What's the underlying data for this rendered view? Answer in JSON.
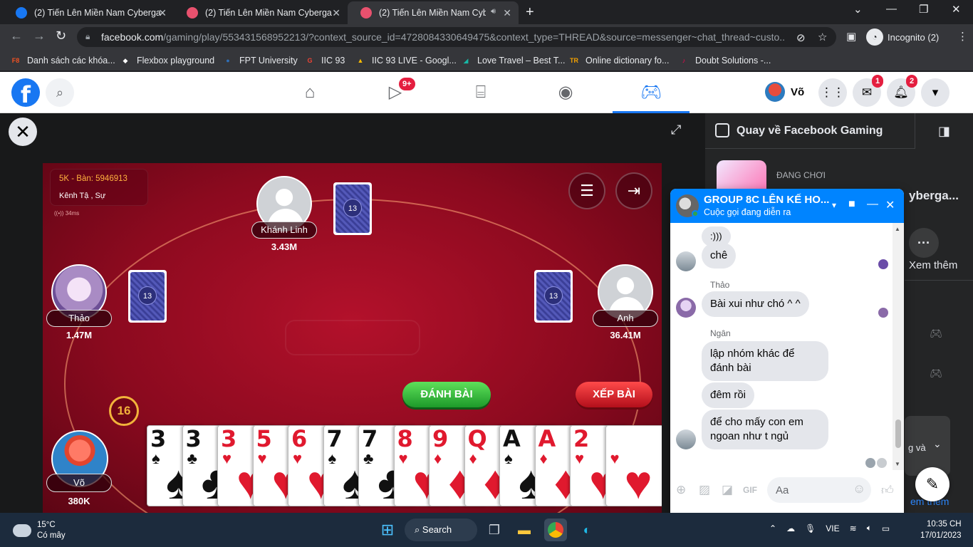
{
  "browser": {
    "tabs": [
      {
        "title": "(2) Tiến Lên Miền Nam Cybergam",
        "active": false
      },
      {
        "title": "(2) Tiến Lên Miền Nam Cybergam",
        "active": false
      },
      {
        "title": "(2) Tiến Lên Miền Nam Cyber",
        "active": true
      }
    ],
    "url_domain": "facebook.com",
    "url_path": "/gaming/play/553431568952213/?context_source_id=4728084330649475&context_type=THREAD&source=messenger~chat_thread~custo...",
    "incognito_label": "Incognito (2)",
    "bookmarks": [
      {
        "label": "Danh sách các khóa...",
        "icon": "F8",
        "color": "#f05123"
      },
      {
        "label": "Flexbox playground",
        "icon": "◆",
        "color": "#ffffff"
      },
      {
        "label": "FPT University",
        "icon": "●",
        "color": "#2f6fb8"
      },
      {
        "label": "IIC 93",
        "icon": "G",
        "color": "#ea4335"
      },
      {
        "label": "IIC 93 LIVE - Googl...",
        "icon": "▲",
        "color": "#fbbc04"
      },
      {
        "label": "Love Travel – Best T...",
        "icon": "◢",
        "color": "#17b8a6"
      },
      {
        "label": "Online dictionary fo...",
        "icon": "TR",
        "color": "#f4a100"
      },
      {
        "label": "Doubt Solutions -...",
        "icon": "♪",
        "color": "#ff0050"
      }
    ]
  },
  "facebook": {
    "logo": "f",
    "video_badge": "9+",
    "user_name": "Võ",
    "messenger_badge": "1",
    "notification_badge": "2",
    "colors": {
      "brand": "#1877f2",
      "badge": "#e41e3f"
    }
  },
  "game": {
    "room_line1": "5K - Bàn: 5946913",
    "room_line2": "Kênh Tậ , Sự",
    "ping": "34ms",
    "players": {
      "top": {
        "name": "Khánh Linh",
        "money": "3.43M",
        "cards": "13"
      },
      "left": {
        "name": "Thảo",
        "money": "1.47M",
        "cards": "13"
      },
      "right": {
        "name": "Anh",
        "money": "36.41M",
        "cards": "13"
      },
      "me": {
        "name": "Võ",
        "money": "380K"
      }
    },
    "timer": "16",
    "play_button": "ĐÁNH BÀI",
    "sort_button": "XẾP BÀI",
    "hand": [
      {
        "rank": "3",
        "suit": "♠",
        "color": "black"
      },
      {
        "rank": "3",
        "suit": "♣",
        "color": "black"
      },
      {
        "rank": "3",
        "suit": "♥",
        "color": "red"
      },
      {
        "rank": "5",
        "suit": "♥",
        "color": "red"
      },
      {
        "rank": "6",
        "suit": "♥",
        "color": "red"
      },
      {
        "rank": "7",
        "suit": "♠",
        "color": "black"
      },
      {
        "rank": "7",
        "suit": "♣",
        "color": "black"
      },
      {
        "rank": "8",
        "suit": "♥",
        "color": "red"
      },
      {
        "rank": "9",
        "suit": "♦",
        "color": "red"
      },
      {
        "rank": "Q",
        "suit": "♦",
        "color": "red"
      },
      {
        "rank": "A",
        "suit": "♠",
        "color": "black"
      },
      {
        "rank": "A",
        "suit": "♦",
        "color": "red"
      },
      {
        "rank": "2",
        "suit": "♥",
        "color": "red"
      },
      {
        "rank": "",
        "suit": "♥",
        "color": "red"
      }
    ]
  },
  "sidebar": {
    "back_label": "Quay về Facebook Gaming",
    "playing_label": "ĐANG CHƠI",
    "game_title_fragment": "yberga...",
    "more_label": "Xem thêm",
    "panel_fragment": "g và",
    "link_fragment": "em thêm"
  },
  "chat": {
    "group_name": "GROUP 8C LÊN KẾ HO...",
    "status": "Cuộc gọi đang diễn ra",
    "messages": [
      {
        "sender": "",
        "text": ":)))"
      },
      {
        "sender": "",
        "text": "chê"
      },
      {
        "sender": "Thảo",
        "text": "Bài xui như chó ^ ^"
      },
      {
        "sender": "Ngân",
        "text": "lập nhóm khác để đánh bài"
      },
      {
        "sender": "",
        "text": "đêm rồi"
      },
      {
        "sender": "",
        "text": "để cho mấy con em ngoan như t ngủ"
      }
    ],
    "input_placeholder": "Aa"
  },
  "taskbar": {
    "weather_temp": "15°C",
    "weather_desc": "Có mây",
    "search_label": "Search",
    "language": "VIE",
    "time": "10:35 CH",
    "date": "17/01/2023"
  }
}
